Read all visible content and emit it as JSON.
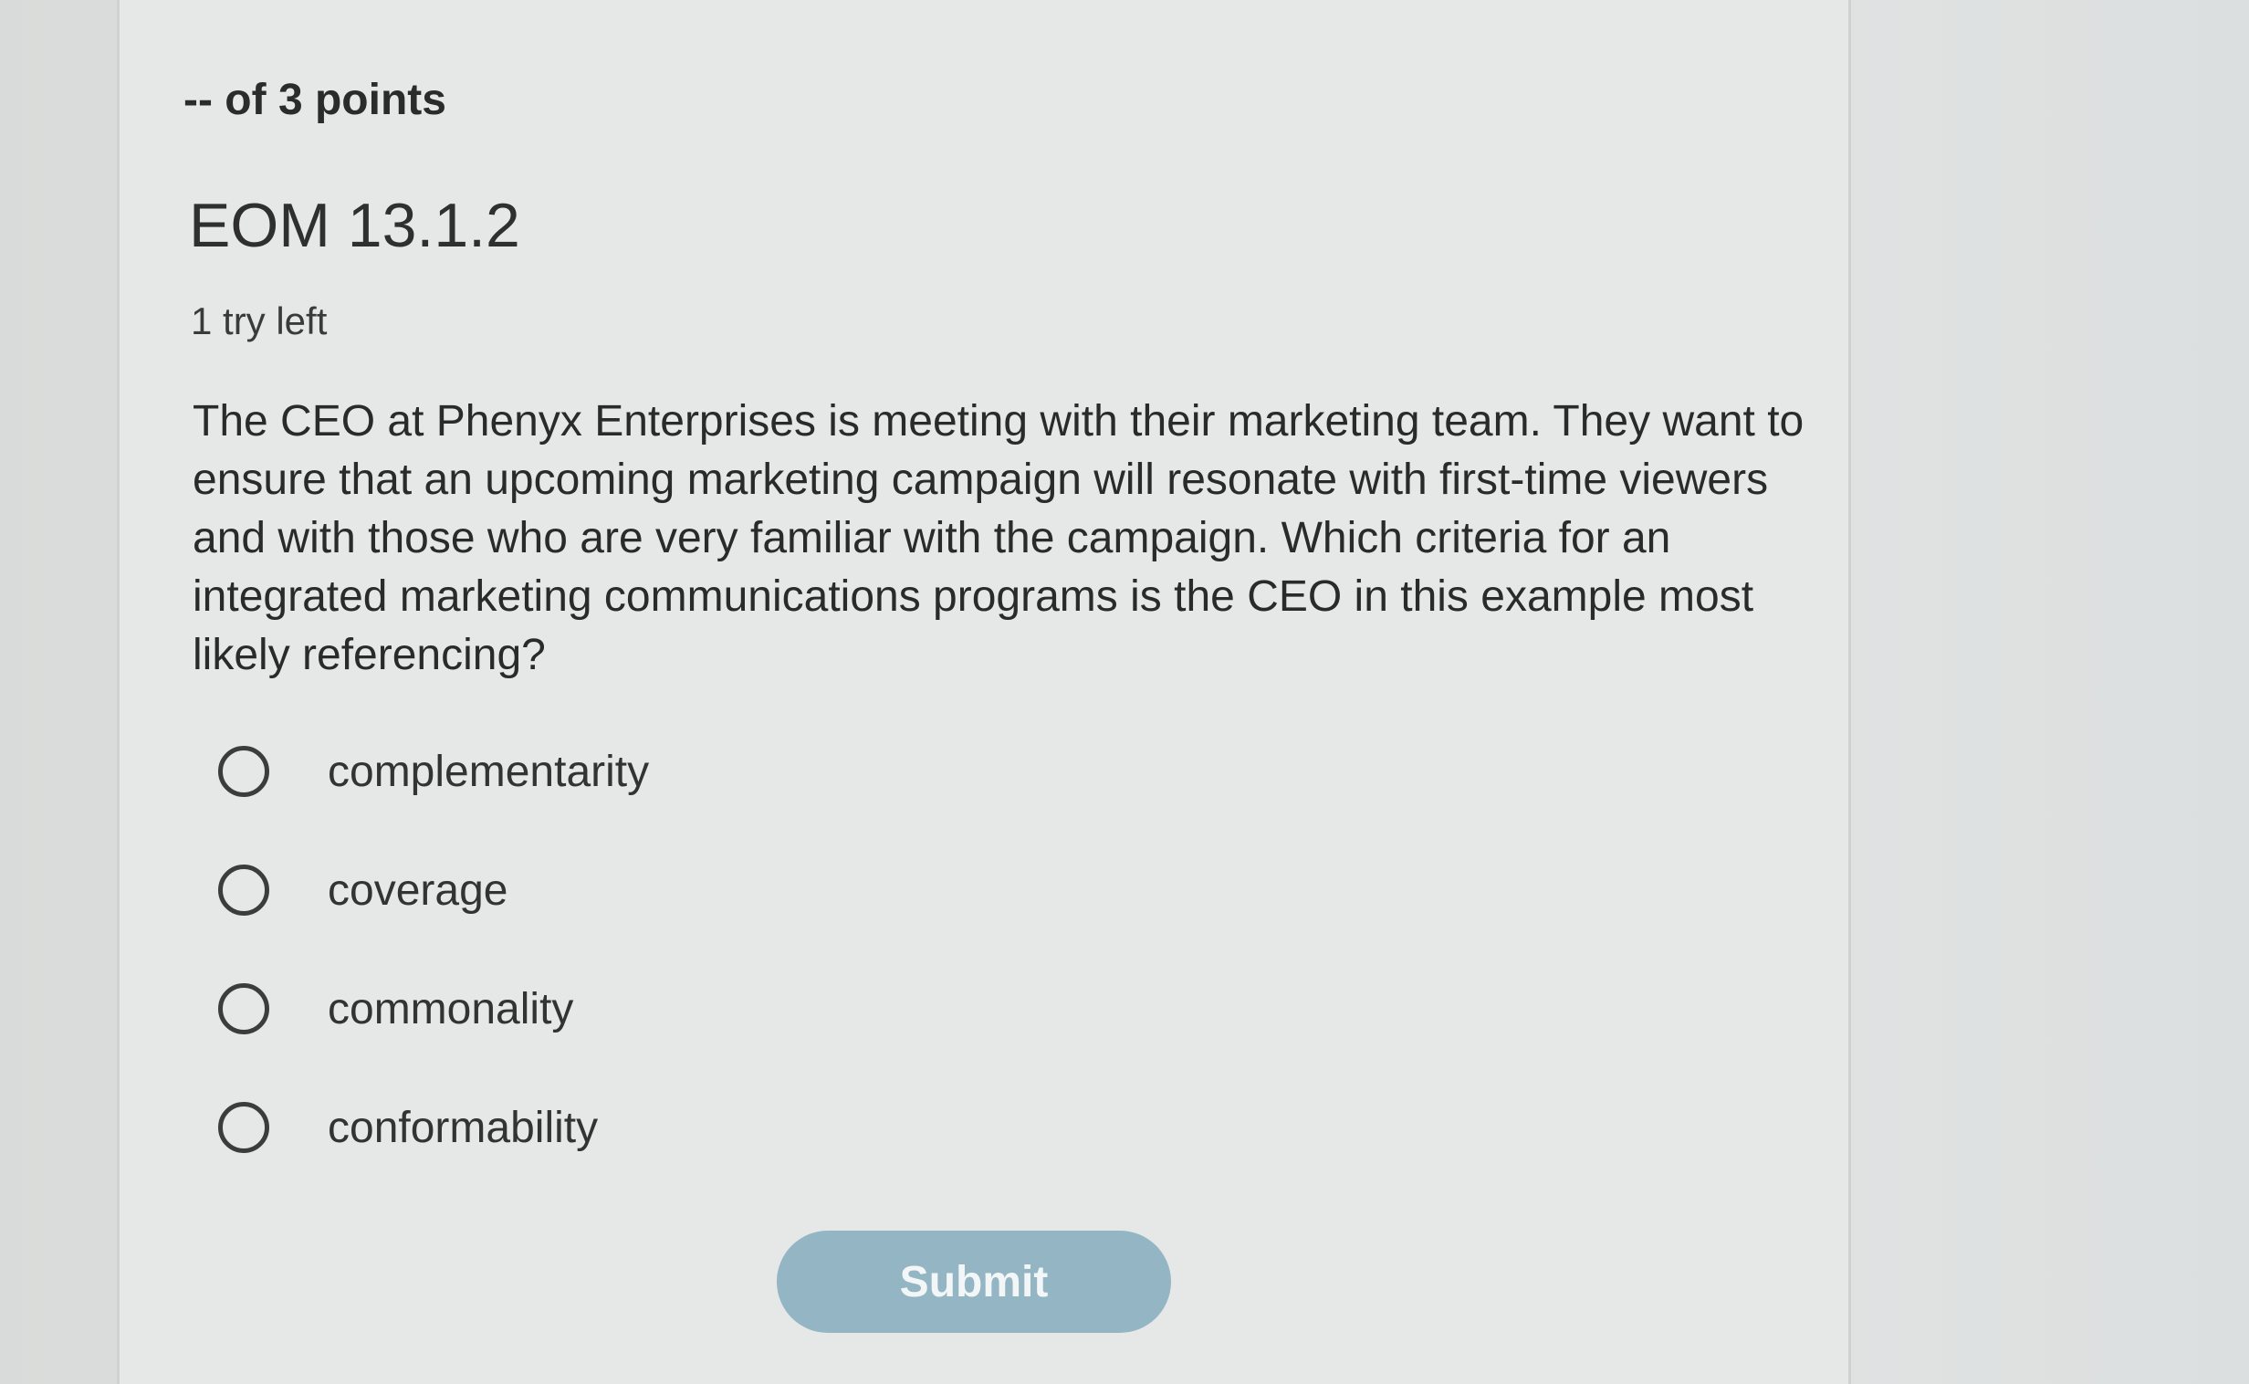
{
  "question": {
    "points": "-- of 3 points",
    "id": "EOM 13.1.2",
    "tries": "1 try left",
    "text": "The CEO at Phenyx Enterprises is meeting with their marketing team. They want to ensure that an upcoming marketing campaign will resonate with first-time viewers and with those who are very familiar with the campaign. Which criteria for an integrated marketing communications programs is the CEO in this example most likely referencing?",
    "options": [
      {
        "label": "complementarity",
        "selected": false
      },
      {
        "label": "coverage",
        "selected": false
      },
      {
        "label": "commonality",
        "selected": false
      },
      {
        "label": "conformability",
        "selected": false
      }
    ]
  },
  "actions": {
    "submit_label": "Submit"
  },
  "colors": {
    "submit_button": "#94b6c4",
    "card_background": "#e6e8e7"
  }
}
